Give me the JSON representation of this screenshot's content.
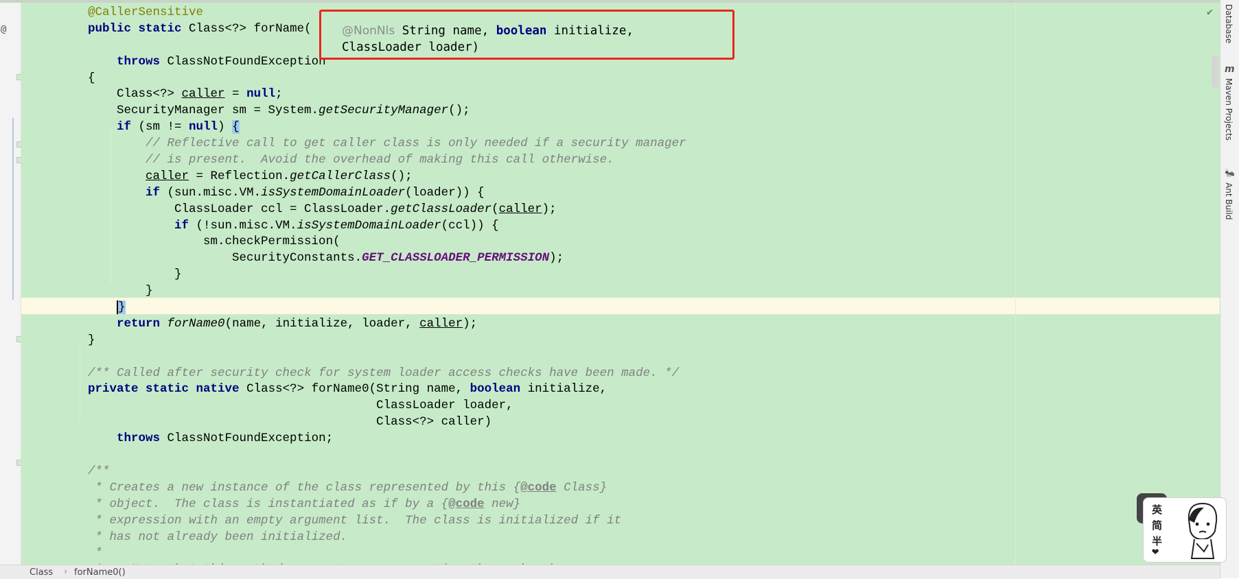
{
  "code_lines": [
    [
      {
        "t": "    "
      },
      {
        "t": "@CallerSensitive",
        "c": "ann"
      }
    ],
    [
      {
        "t": "    "
      },
      {
        "t": "public static",
        "c": "kw"
      },
      {
        "t": " Class<?> forName("
      }
    ],
    [],
    [
      {
        "t": "        "
      },
      {
        "t": "throws",
        "c": "kw"
      },
      {
        "t": " ClassNotFoundException"
      }
    ],
    [
      {
        "t": "    {"
      }
    ],
    [
      {
        "t": "        Class<?> "
      },
      {
        "t": "caller",
        "c": "ul"
      },
      {
        "t": " = "
      },
      {
        "t": "null",
        "c": "kw"
      },
      {
        "t": ";"
      }
    ],
    [
      {
        "t": "        SecurityManager sm = System."
      },
      {
        "t": "getSecurityManager",
        "c": "it"
      },
      {
        "t": "();"
      }
    ],
    [
      {
        "t": "        "
      },
      {
        "t": "if",
        "c": "kw"
      },
      {
        "t": " (sm != "
      },
      {
        "t": "null",
        "c": "kw"
      },
      {
        "t": ") "
      },
      {
        "t": "{",
        "c": "hlb"
      }
    ],
    [
      {
        "t": "            "
      },
      {
        "t": "// Reflective call to get caller class is only needed if a security manager",
        "c": "cm"
      }
    ],
    [
      {
        "t": "            "
      },
      {
        "t": "// is present.  Avoid the overhead of making this call otherwise.",
        "c": "cm"
      }
    ],
    [
      {
        "t": "            "
      },
      {
        "t": "caller",
        "c": "ul"
      },
      {
        "t": " = Reflection."
      },
      {
        "t": "getCallerClass",
        "c": "it"
      },
      {
        "t": "();"
      }
    ],
    [
      {
        "t": "            "
      },
      {
        "t": "if",
        "c": "kw"
      },
      {
        "t": " (sun.misc.VM."
      },
      {
        "t": "isSystemDomainLoader",
        "c": "it"
      },
      {
        "t": "(loader)) {"
      }
    ],
    [
      {
        "t": "                ClassLoader ccl = ClassLoader."
      },
      {
        "t": "getClassLoader",
        "c": "it"
      },
      {
        "t": "("
      },
      {
        "t": "caller",
        "c": "ul"
      },
      {
        "t": ");"
      }
    ],
    [
      {
        "t": "                "
      },
      {
        "t": "if",
        "c": "kw"
      },
      {
        "t": " (!sun.misc.VM."
      },
      {
        "t": "isSystemDomainLoader",
        "c": "it"
      },
      {
        "t": "(ccl)) {"
      }
    ],
    [
      {
        "t": "                    sm.checkPermission("
      }
    ],
    [
      {
        "t": "                        SecurityConstants."
      },
      {
        "t": "GET_CLASSLOADER_PERMISSION",
        "c": "cst"
      },
      {
        "t": ");"
      }
    ],
    [
      {
        "t": "                }"
      }
    ],
    [
      {
        "t": "            }"
      }
    ],
    [
      {
        "t": "        "
      },
      {
        "t": "}",
        "c": "hlb cursor"
      }
    ],
    [
      {
        "t": "        "
      },
      {
        "t": "return",
        "c": "kw"
      },
      {
        "t": " "
      },
      {
        "t": "forName0",
        "c": "it"
      },
      {
        "t": "(name, initialize, loader, "
      },
      {
        "t": "caller",
        "c": "ul"
      },
      {
        "t": ");"
      }
    ],
    [
      {
        "t": "    }"
      }
    ],
    [],
    [
      {
        "t": "    "
      },
      {
        "t": "/** Called after security check for system loader access checks have been made. */",
        "c": "cm"
      }
    ],
    [
      {
        "t": "    "
      },
      {
        "t": "private static native",
        "c": "kw"
      },
      {
        "t": " Class<?> forName0(String name, "
      },
      {
        "t": "boolean",
        "c": "kw"
      },
      {
        "t": " initialize,"
      }
    ],
    [
      {
        "t": "                                            ClassLoader loader,"
      }
    ],
    [
      {
        "t": "                                            Class<?> caller)"
      }
    ],
    [
      {
        "t": "        "
      },
      {
        "t": "throws",
        "c": "kw"
      },
      {
        "t": " ClassNotFoundException;"
      }
    ],
    [],
    [
      {
        "t": "    "
      },
      {
        "t": "/**",
        "c": "cm"
      }
    ],
    [
      {
        "t": "     "
      },
      {
        "t": "* Creates a new instance of the class represented by this {",
        "c": "cm"
      },
      {
        "t": "@code",
        "c": "tag"
      },
      {
        "t": " Class}",
        "c": "cm"
      }
    ],
    [
      {
        "t": "     "
      },
      {
        "t": "* object.  The class is instantiated as if by a {",
        "c": "cm"
      },
      {
        "t": "@code",
        "c": "tag"
      },
      {
        "t": " new}",
        "c": "cm"
      }
    ],
    [
      {
        "t": "     "
      },
      {
        "t": "* expression with an empty argument list.  The class is initialized if it",
        "c": "cm"
      }
    ],
    [
      {
        "t": "     "
      },
      {
        "t": "* has not already been initialized.",
        "c": "cm"
      }
    ],
    [
      {
        "t": "     "
      },
      {
        "t": "*",
        "c": "cm"
      }
    ],
    [
      {
        "t": "     "
      },
      {
        "t": "* <p>Note that this method propagates any exception thrown by the",
        "c": "cm"
      }
    ]
  ],
  "param_hint": {
    "annotation": "@NonNls",
    "line1": " String name, ",
    "line1_kw": "boolean",
    "line1_end": " initialize,",
    "line2": "ClassLoader loader)"
  },
  "gutter": {
    "at_marker": "@"
  },
  "right_toolbar": {
    "database": "Database",
    "maven": "Maven Projects",
    "ant": "Ant Build",
    "maven_icon": "m",
    "ant_icon": "🐜"
  },
  "breadcrumb": {
    "items": [
      "Class",
      "forName0()"
    ],
    "separator": "›"
  },
  "widget": {
    "chars": [
      "英",
      "简",
      "半"
    ],
    "heart": "❤"
  },
  "colors": {
    "editor_bg": "#c7ebc9",
    "keyword": "#000080",
    "annotation": "#808000",
    "comment": "#808080",
    "constant": "#660e7a",
    "highlight_box": "#e8261e"
  },
  "icons": {
    "inspection": "check-icon"
  }
}
